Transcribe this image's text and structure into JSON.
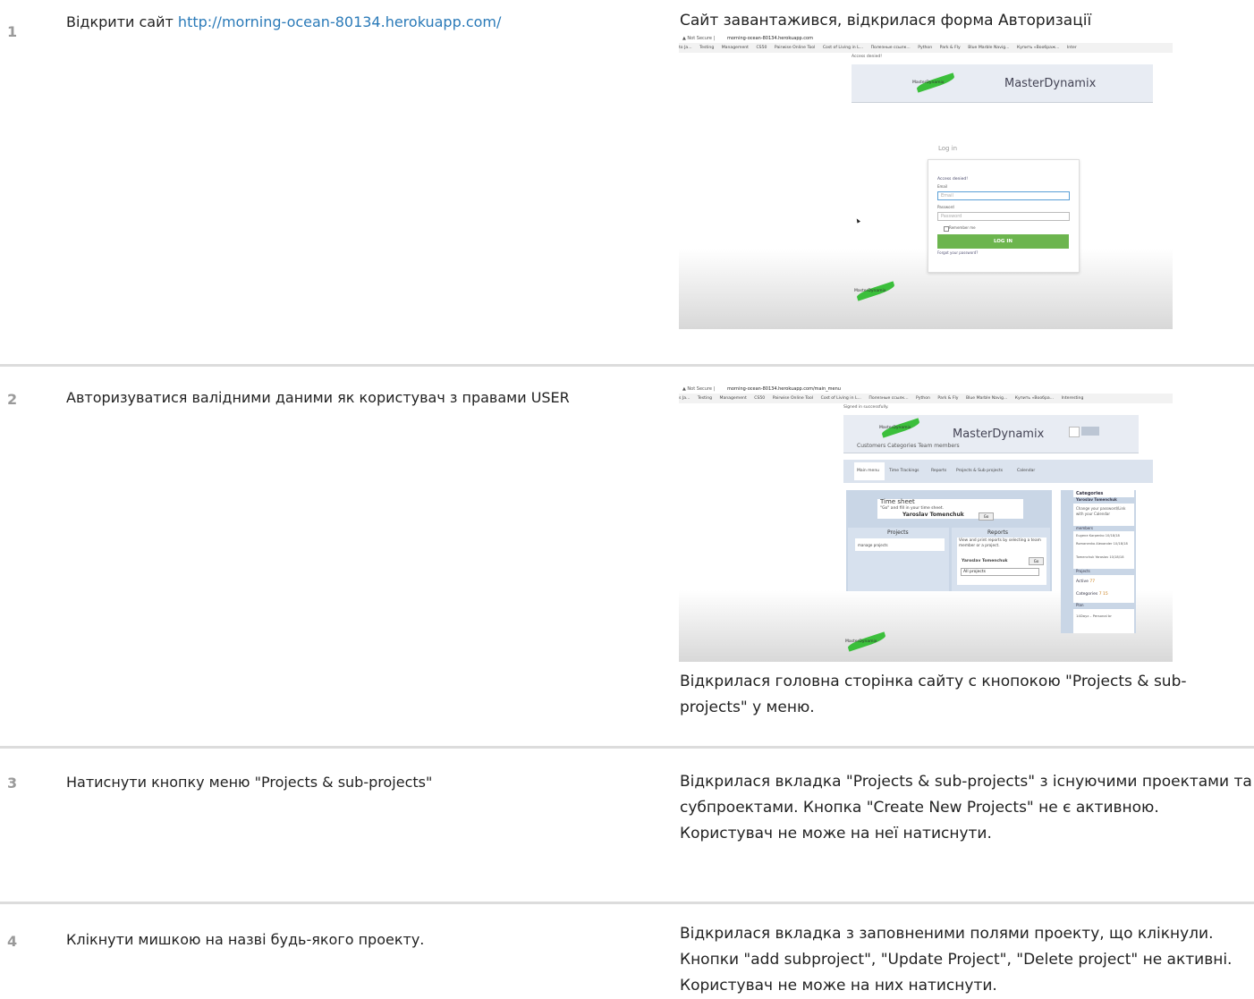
{
  "steps": [
    {
      "num": "1",
      "action_text": "Відкрити сайт ",
      "action_link": "http://morning-ocean-80134.herokuapp.com/",
      "result_title": "Сайт завантажився, відкрилася форма Авторизації"
    },
    {
      "num": "2",
      "action_text": "Авторизуватися валідними даними як користувач з правами USER",
      "result_text": "Відкрилася головна сторінка сайту с кнопокою \"Projects & sub-projects\" у меню."
    },
    {
      "num": "3",
      "action_text": "Натиснути кнопку меню \"Projects & sub-projects\"",
      "result_text": "Відкрилася вкладка \"Projects & sub-projects\" з існуючими проектами та субпроектами. Кнопка \"Create New Projects\" не є активною. Користувач не може на неї натиснути."
    },
    {
      "num": "4",
      "action_text": "Клікнути мишкою на назві будь-якого проекту.",
      "result_text": "Відкрилася вкладка з заповненими полями проекту, що клікнули. Кнопки  \"add subproject\", \"Update Project\", \"Delete project\" не активні. Користувач не може на них натиснути."
    }
  ],
  "shot1": {
    "url_prefix": "▲ Not Secure  |  ",
    "url": "morning-ocean-80134.herokuapp.com",
    "bookmarks": [
      "to Ja...",
      "Testing",
      "Management",
      "CS50",
      "Pairwise Online Tool",
      "Cost of Living in L...",
      "Полезные ссылк...",
      "Python",
      "Park & Fly",
      "Blue Marble Navig...",
      "Купить «Воображ...",
      "Inter"
    ],
    "access_denied": "Access denied!",
    "brand": "MasterDynamix",
    "logo_text": "MasterDynamix",
    "login_title": "Log in",
    "form_access_denied": "Access denied!",
    "email_label": "Email",
    "email_placeholder": "Email",
    "password_label": "Password",
    "password_placeholder": "Password",
    "remember": "Remember me",
    "login_button": "LOG IN",
    "forgot": "Forgot your password?"
  },
  "shot2": {
    "url_prefix": "▲ Not Secure  |  ",
    "url": "morning-ocean-80134.herokuapp.com/main_menu",
    "bookmarks": [
      "s Ja...",
      "Testing",
      "Management",
      "CS50",
      "Pairwise Online Tool",
      "Cost of Living in L...",
      "Полезные ссылк...",
      "Python",
      "Park & Fly",
      "Blue Marble Navig...",
      "Купить «Вообра...",
      "Interesting"
    ],
    "signed_in": "Signed in successfully.",
    "brand": "MasterDynamix",
    "logo_text": "MasterDynamix",
    "top_links": "Customers  Categories  Team members",
    "menu": [
      "Main menu",
      "Time Trackings",
      "Reports",
      "Projects & Sub projects",
      "Calendar"
    ],
    "time_sheet_title": "Time sheet",
    "time_sheet_text": "\"Go\" and fill in your time sheet.",
    "user_name": "Yaroslav Tomenchuk",
    "go": "Go",
    "projects_title": "Projects",
    "manage_projects": "manage projects",
    "reports_title": "Reports",
    "reports_text": "View and print reports by selecting a team member or a project.",
    "reports_user": "Yaroslav Tomenchuk",
    "all_projects": "All projects",
    "categories_title": "Categories",
    "side_user": "Yaroslav Tomenchuk",
    "side_change": "Change your password/Link with your Calendar",
    "members_label": "members",
    "members": [
      "Eugene Karpenko 10/18/18",
      "Romanenko Alexander 10/18/18",
      "Tomenchuk Yaroslav 10/18/18"
    ],
    "projects_label": "Projects",
    "active": "Active",
    "active_num": "77",
    "categories_label": "Categories",
    "categories_num": "7 15",
    "plan_label": "Plan",
    "plan_item": "14Dayz – Personal br"
  }
}
